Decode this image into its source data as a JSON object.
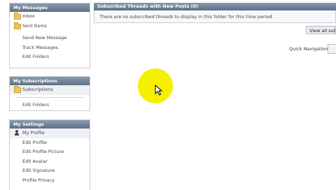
{
  "my_messages": {
    "title": "My Messages",
    "folders": [
      "Inbox",
      "Sent Items"
    ],
    "links": [
      "Send New Message",
      "Track Messages",
      "Edit Folders"
    ]
  },
  "my_subscriptions": {
    "title": "My Subscriptions",
    "folder": "Subscriptions",
    "edit": "Edit Folders"
  },
  "my_settings": {
    "title": "My Settings",
    "profile": "My Profile",
    "links": [
      "Edit Profile",
      "Edit Profile Picture",
      "Edit Avatar",
      "Edit Signature",
      "Profile Privacy"
    ]
  },
  "main": {
    "header": "Subscribed Threads with New Posts (0)",
    "message": "There are no subscribed threads to display in this folder for this time period.",
    "view_all": "View all subscriptions",
    "quick_nav": "Quick Navigation"
  },
  "colors": {
    "header_bg": "#6d7e94",
    "highlight": "#f4f000"
  }
}
